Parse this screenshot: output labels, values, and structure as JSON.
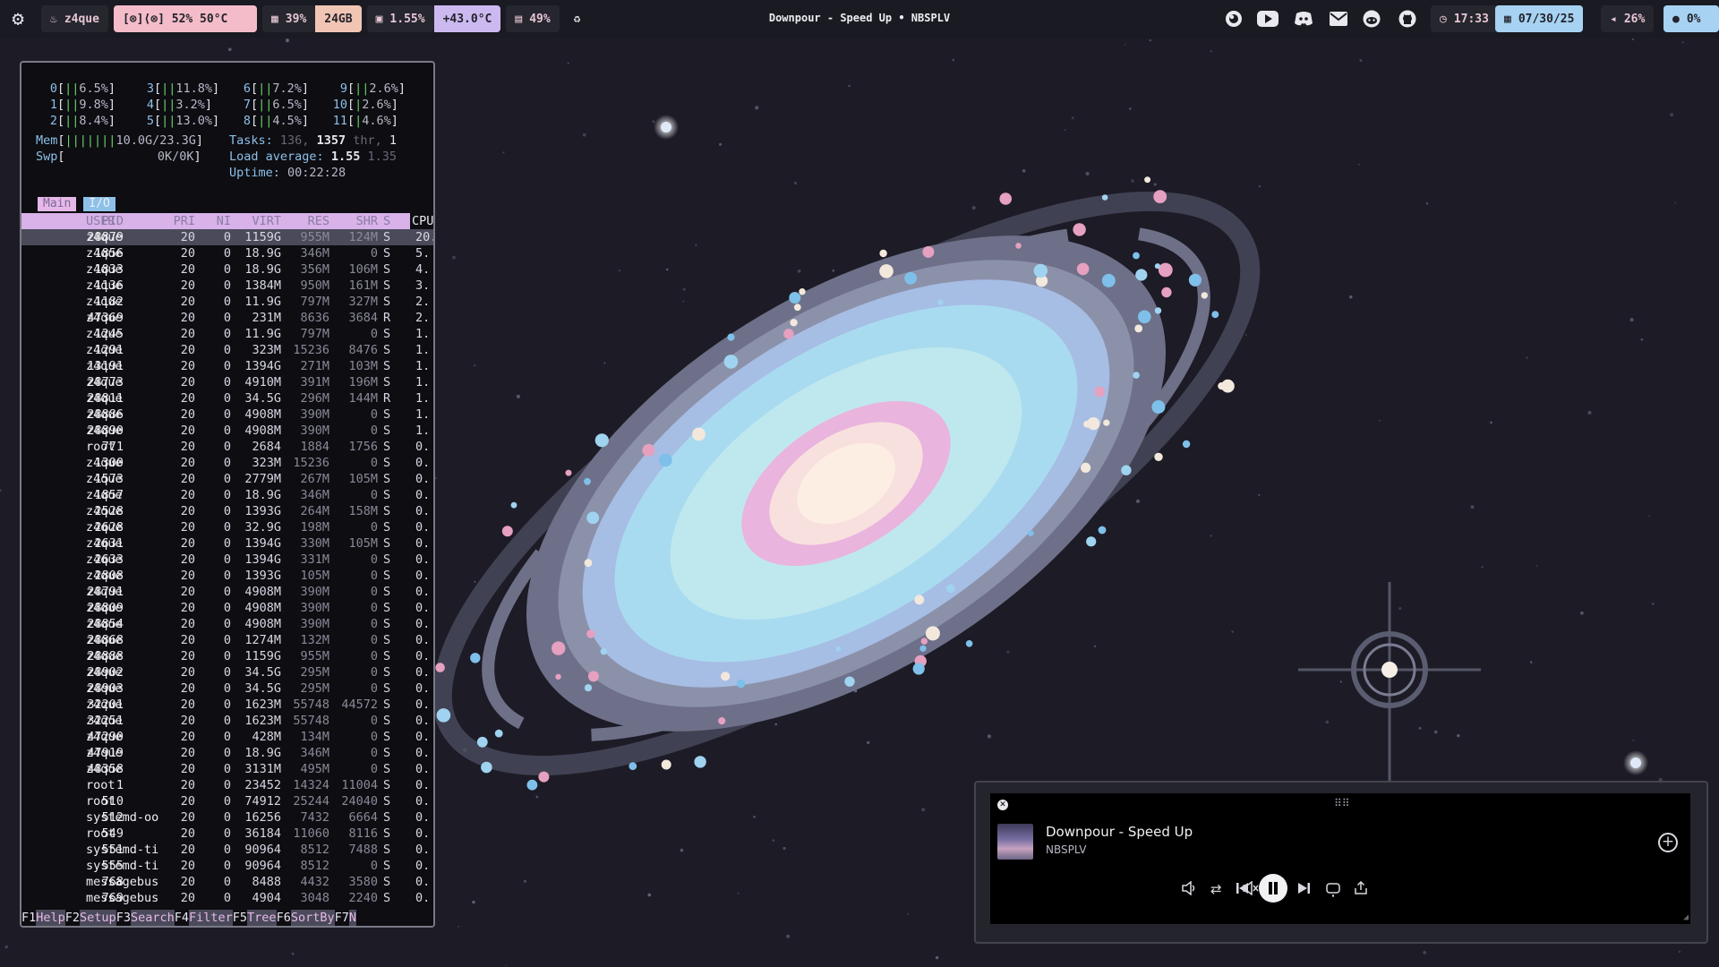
{
  "topbar": {
    "user": "z4que",
    "temp_display": "[⊗]⟨⊗] 52% 50°C",
    "ram_percent": "39%",
    "ram_total": "24GB",
    "cpu_load": "1.55%",
    "cpu_temp": "+43.0°C",
    "disk": "49%",
    "now_playing": "Downpour - Speed Up • NBSPLV",
    "time": "17:33",
    "date": "07/30/25",
    "volume": "26%",
    "mic": "0%"
  },
  "htop": {
    "cpus": [
      {
        "id": "0",
        "bars": "||",
        "pct": "6.5%"
      },
      {
        "id": "1",
        "bars": "||",
        "pct": "9.8%"
      },
      {
        "id": "2",
        "bars": "||",
        "pct": "8.4%"
      },
      {
        "id": "3",
        "bars": "||",
        "pct": "11.8%"
      },
      {
        "id": "4",
        "bars": "||",
        "pct": "3.2%"
      },
      {
        "id": "5",
        "bars": "||",
        "pct": "13.0%"
      },
      {
        "id": "6",
        "bars": "||",
        "pct": "7.2%"
      },
      {
        "id": "7",
        "bars": "||",
        "pct": "6.5%"
      },
      {
        "id": "8",
        "bars": "||",
        "pct": "4.5%"
      },
      {
        "id": "9",
        "bars": "||",
        "pct": "2.6%"
      },
      {
        "id": "10",
        "bars": "|",
        "pct": "2.6%"
      },
      {
        "id": "11",
        "bars": "|",
        "pct": "4.6%"
      }
    ],
    "mem_label": "Mem",
    "mem_bars": "|||||||",
    "mem_value": "10.0G/23.3G",
    "swp_label": "Swp",
    "swp_value": "0K/0K",
    "tasks_label": "Tasks:",
    "tasks": "136,",
    "threads": "1357",
    "threads_label": "thr,",
    "running": "1",
    "load_label": "Load average:",
    "load1": "1.55",
    "load5": "1.35",
    "uptime_label": "Uptime:",
    "uptime": "00:22:28",
    "tab_main": "Main",
    "tab_io": "I/O",
    "headers": {
      "pid": "PID",
      "user": "USER",
      "pri": "PRI",
      "ni": "NI",
      "virt": "VIRT",
      "res": "RES",
      "shr": "SHR",
      "s": "S",
      "cpu": "CPU"
    },
    "processes": [
      {
        "pid": "28879",
        "user": "z4que",
        "pri": "20",
        "ni": "0",
        "virt": "1159G",
        "res": "955M",
        "shr": "124M",
        "s": "S",
        "cpu": "20."
      },
      {
        "pid": "1856",
        "user": "z4que",
        "pri": "20",
        "ni": "0",
        "virt": "18.9G",
        "res": "346M",
        "shr": "0",
        "s": "S",
        "cpu": "5."
      },
      {
        "pid": "1833",
        "user": "z4que",
        "pri": "20",
        "ni": "0",
        "virt": "18.9G",
        "res": "356M",
        "shr": "106M",
        "s": "S",
        "cpu": "4."
      },
      {
        "pid": "1136",
        "user": "z4que",
        "pri": "20",
        "ni": "0",
        "virt": "1384M",
        "res": "950M",
        "shr": "161M",
        "s": "S",
        "cpu": "3."
      },
      {
        "pid": "1182",
        "user": "z4que",
        "pri": "20",
        "ni": "0",
        "virt": "11.9G",
        "res": "797M",
        "shr": "327M",
        "s": "S",
        "cpu": "2."
      },
      {
        "pid": "47369",
        "user": "z4que",
        "pri": "20",
        "ni": "0",
        "virt": "231M",
        "res": "8636",
        "shr": "3684",
        "s": "R",
        "cpu": "2."
      },
      {
        "pid": "1245",
        "user": "z4que",
        "pri": "20",
        "ni": "0",
        "virt": "11.9G",
        "res": "797M",
        "shr": "0",
        "s": "S",
        "cpu": "1."
      },
      {
        "pid": "1291",
        "user": "z4que",
        "pri": "20",
        "ni": "0",
        "virt": "323M",
        "res": "15236",
        "shr": "8476",
        "s": "S",
        "cpu": "1."
      },
      {
        "pid": "13191",
        "user": "z4que",
        "pri": "20",
        "ni": "0",
        "virt": "1394G",
        "res": "271M",
        "shr": "103M",
        "s": "S",
        "cpu": "1."
      },
      {
        "pid": "28773",
        "user": "z4que",
        "pri": "20",
        "ni": "0",
        "virt": "4910M",
        "res": "391M",
        "shr": "196M",
        "s": "S",
        "cpu": "1."
      },
      {
        "pid": "28811",
        "user": "z4que",
        "pri": "20",
        "ni": "0",
        "virt": "34.5G",
        "res": "296M",
        "shr": "144M",
        "s": "R",
        "cpu": "1."
      },
      {
        "pid": "28886",
        "user": "z4que",
        "pri": "20",
        "ni": "0",
        "virt": "4908M",
        "res": "390M",
        "shr": "0",
        "s": "S",
        "cpu": "1."
      },
      {
        "pid": "28890",
        "user": "z4que",
        "pri": "20",
        "ni": "0",
        "virt": "4908M",
        "res": "390M",
        "shr": "0",
        "s": "S",
        "cpu": "1."
      },
      {
        "pid": "771",
        "user": "root",
        "pri": "20",
        "ni": "0",
        "virt": "2684",
        "res": "1884",
        "shr": "1756",
        "s": "S",
        "cpu": "0."
      },
      {
        "pid": "1300",
        "user": "z4que",
        "pri": "20",
        "ni": "0",
        "virt": "323M",
        "res": "15236",
        "shr": "0",
        "s": "S",
        "cpu": "0."
      },
      {
        "pid": "1573",
        "user": "z4que",
        "pri": "20",
        "ni": "0",
        "virt": "2779M",
        "res": "267M",
        "shr": "105M",
        "s": "S",
        "cpu": "0."
      },
      {
        "pid": "1857",
        "user": "z4que",
        "pri": "20",
        "ni": "0",
        "virt": "18.9G",
        "res": "346M",
        "shr": "0",
        "s": "S",
        "cpu": "0."
      },
      {
        "pid": "2528",
        "user": "z4que",
        "pri": "20",
        "ni": "0",
        "virt": "1393G",
        "res": "264M",
        "shr": "158M",
        "s": "S",
        "cpu": "0."
      },
      {
        "pid": "2628",
        "user": "z4que",
        "pri": "20",
        "ni": "0",
        "virt": "32.9G",
        "res": "198M",
        "shr": "0",
        "s": "S",
        "cpu": "0."
      },
      {
        "pid": "2631",
        "user": "z4que",
        "pri": "20",
        "ni": "0",
        "virt": "1394G",
        "res": "330M",
        "shr": "105M",
        "s": "S",
        "cpu": "0."
      },
      {
        "pid": "2633",
        "user": "z4que",
        "pri": "20",
        "ni": "0",
        "virt": "1394G",
        "res": "331M",
        "shr": "0",
        "s": "S",
        "cpu": "0."
      },
      {
        "pid": "2808",
        "user": "z4que",
        "pri": "20",
        "ni": "0",
        "virt": "1393G",
        "res": "105M",
        "shr": "0",
        "s": "S",
        "cpu": "0."
      },
      {
        "pid": "28791",
        "user": "z4que",
        "pri": "20",
        "ni": "0",
        "virt": "4908M",
        "res": "390M",
        "shr": "0",
        "s": "S",
        "cpu": "0."
      },
      {
        "pid": "28809",
        "user": "z4que",
        "pri": "20",
        "ni": "0",
        "virt": "4908M",
        "res": "390M",
        "shr": "0",
        "s": "S",
        "cpu": "0."
      },
      {
        "pid": "28854",
        "user": "z4que",
        "pri": "20",
        "ni": "0",
        "virt": "4908M",
        "res": "390M",
        "shr": "0",
        "s": "S",
        "cpu": "0."
      },
      {
        "pid": "28868",
        "user": "z4que",
        "pri": "20",
        "ni": "0",
        "virt": "1274M",
        "res": "132M",
        "shr": "0",
        "s": "S",
        "cpu": "0."
      },
      {
        "pid": "28888",
        "user": "z4que",
        "pri": "20",
        "ni": "0",
        "virt": "1159G",
        "res": "955M",
        "shr": "0",
        "s": "S",
        "cpu": "0."
      },
      {
        "pid": "28902",
        "user": "z4que",
        "pri": "20",
        "ni": "0",
        "virt": "34.5G",
        "res": "295M",
        "shr": "0",
        "s": "S",
        "cpu": "0."
      },
      {
        "pid": "28903",
        "user": "z4que",
        "pri": "20",
        "ni": "0",
        "virt": "34.5G",
        "res": "295M",
        "shr": "0",
        "s": "S",
        "cpu": "0."
      },
      {
        "pid": "32201",
        "user": "z4que",
        "pri": "20",
        "ni": "0",
        "virt": "1623M",
        "res": "55748",
        "shr": "44572",
        "s": "S",
        "cpu": "0."
      },
      {
        "pid": "32251",
        "user": "z4que",
        "pri": "20",
        "ni": "0",
        "virt": "1623M",
        "res": "55748",
        "shr": "0",
        "s": "S",
        "cpu": "0."
      },
      {
        "pid": "47290",
        "user": "z4que",
        "pri": "20",
        "ni": "0",
        "virt": "428M",
        "res": "134M",
        "shr": "0",
        "s": "S",
        "cpu": "0."
      },
      {
        "pid": "47919",
        "user": "z4que",
        "pri": "20",
        "ni": "0",
        "virt": "18.9G",
        "res": "346M",
        "shr": "0",
        "s": "S",
        "cpu": "0."
      },
      {
        "pid": "48358",
        "user": "z4que",
        "pri": "20",
        "ni": "0",
        "virt": "3131M",
        "res": "495M",
        "shr": "0",
        "s": "S",
        "cpu": "0."
      },
      {
        "pid": "1",
        "user": "root",
        "pri": "20",
        "ni": "0",
        "virt": "23452",
        "res": "14324",
        "shr": "11004",
        "s": "S",
        "cpu": "0."
      },
      {
        "pid": "510",
        "user": "root",
        "pri": "20",
        "ni": "0",
        "virt": "74912",
        "res": "25244",
        "shr": "24040",
        "s": "S",
        "cpu": "0."
      },
      {
        "pid": "512",
        "user": "systemd-oo",
        "pri": "20",
        "ni": "0",
        "virt": "16256",
        "res": "7432",
        "shr": "6664",
        "s": "S",
        "cpu": "0."
      },
      {
        "pid": "549",
        "user": "root",
        "pri": "20",
        "ni": "0",
        "virt": "36184",
        "res": "11060",
        "shr": "8116",
        "s": "S",
        "cpu": "0."
      },
      {
        "pid": "551",
        "user": "systemd-ti",
        "pri": "20",
        "ni": "0",
        "virt": "90964",
        "res": "8512",
        "shr": "7488",
        "s": "S",
        "cpu": "0."
      },
      {
        "pid": "555",
        "user": "systemd-ti",
        "pri": "20",
        "ni": "0",
        "virt": "90964",
        "res": "8512",
        "shr": "0",
        "s": "S",
        "cpu": "0."
      },
      {
        "pid": "768",
        "user": "messagebus",
        "pri": "20",
        "ni": "0",
        "virt": "8488",
        "res": "4432",
        "shr": "3580",
        "s": "S",
        "cpu": "0."
      },
      {
        "pid": "769",
        "user": "messagebus",
        "pri": "20",
        "ni": "0",
        "virt": "4904",
        "res": "3048",
        "shr": "2240",
        "s": "S",
        "cpu": "0."
      }
    ],
    "fkeys": [
      {
        "key": "F1",
        "label": "Help  "
      },
      {
        "key": "F2",
        "label": "Setup "
      },
      {
        "key": "F3",
        "label": "Search"
      },
      {
        "key": "F4",
        "label": "Filter"
      },
      {
        "key": "F5",
        "label": "Tree  "
      },
      {
        "key": "F6",
        "label": "SortBy"
      },
      {
        "key": "F7",
        "label": "N"
      }
    ]
  },
  "player": {
    "title": "Downpour - Speed Up",
    "artist": "NBSPLV"
  },
  "colors": {
    "accent_pink": "#f4bcc9",
    "accent_lavender": "#ccb9f0",
    "accent_blue": "#a7d2f2",
    "bar_bg": "#1a1a22"
  }
}
